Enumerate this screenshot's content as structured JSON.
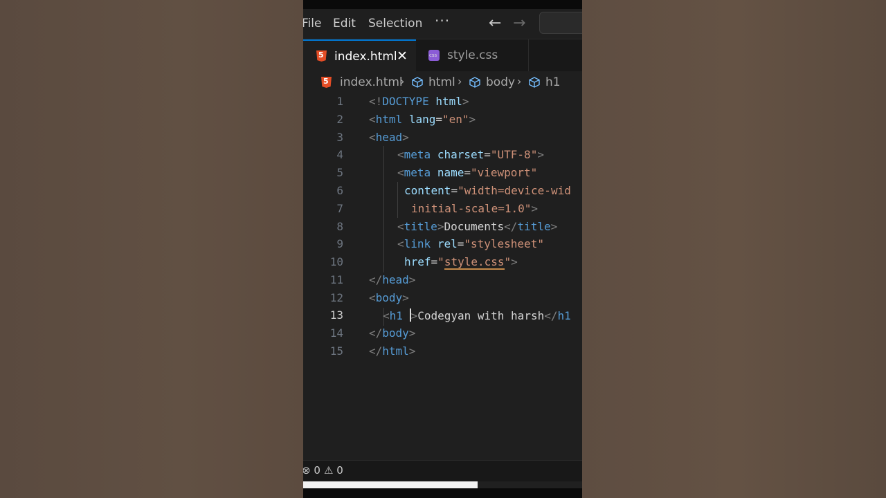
{
  "menubar": {
    "file": "File",
    "edit": "Edit",
    "selection": "Selection",
    "more": "···",
    "back_icon": "arrow-left-icon",
    "forward_icon": "arrow-right-icon"
  },
  "tabs": [
    {
      "label": "index.html",
      "icon": "html5-icon",
      "active": true,
      "close": "✕"
    },
    {
      "label": "style.css",
      "icon": "css-icon",
      "active": false
    }
  ],
  "breadcrumb": [
    "index.html",
    "html",
    "body",
    "h1"
  ],
  "lines": [
    {
      "n": "1"
    },
    {
      "n": "2"
    },
    {
      "n": "3"
    },
    {
      "n": "4"
    },
    {
      "n": "5"
    },
    {
      "n": "6"
    },
    {
      "n": "7"
    },
    {
      "n": "8"
    },
    {
      "n": "9"
    },
    {
      "n": "10"
    },
    {
      "n": "11"
    },
    {
      "n": "12"
    },
    {
      "n": "13"
    },
    {
      "n": "14"
    },
    {
      "n": "15"
    }
  ],
  "code": {
    "l1": {
      "a": "<!",
      "b": "DOCTYPE",
      "c": " ",
      "d": "html",
      "e": ">"
    },
    "l2": {
      "a": "<",
      "b": "html",
      "c": " ",
      "d": "lang",
      "e": "=",
      "f": "\"en\"",
      "g": ">"
    },
    "l3": {
      "a": "<",
      "b": "head",
      "c": ">"
    },
    "l4": {
      "a": "<",
      "b": "meta",
      "c": " ",
      "d": "charset",
      "e": "=",
      "f": "\"UTF-8\"",
      "g": ">"
    },
    "l5": {
      "a": "<",
      "b": "meta",
      "c": " ",
      "d": "name",
      "e": "=",
      "f": "\"viewport\""
    },
    "l6": {
      "d": "content",
      "e": "=",
      "f": "\"width=device-wid"
    },
    "l7": {
      "f": "initial-scale=1.0\"",
      "g": ">"
    },
    "l8": {
      "a": "<",
      "b": "title",
      "c": ">",
      "t": "Documents",
      "d": "</",
      "e": "title",
      "f": ">"
    },
    "l9": {
      "a": "<",
      "b": "link",
      "c": " ",
      "d": "rel",
      "e": "=",
      "f": "\"stylesheet\""
    },
    "l10": {
      "d": "href",
      "e": "=",
      "q1": "\"",
      "f": "style.css",
      "q2": "\"",
      "g": ">"
    },
    "l11": {
      "a": "</",
      "b": "head",
      "c": ">"
    },
    "l12": {
      "a": "<",
      "b": "body",
      "c": ">"
    },
    "l13": {
      "a": "<",
      "b": "h1",
      "c": " ",
      "g": ">",
      "t": "Codegyan with harsh",
      "d": "</",
      "e": "h1"
    },
    "l14": {
      "a": "</",
      "b": "body",
      "c": ">"
    },
    "l15": {
      "a": "</",
      "b": "html",
      "c": ">"
    }
  },
  "status": {
    "errors": "0",
    "warnings": "0",
    "error_icon": "⊗",
    "warning_icon": "⚠"
  },
  "colors": {
    "accent": "#0078d4",
    "html_icon": "#e44d26",
    "css_icon": "#8b5cd6"
  }
}
